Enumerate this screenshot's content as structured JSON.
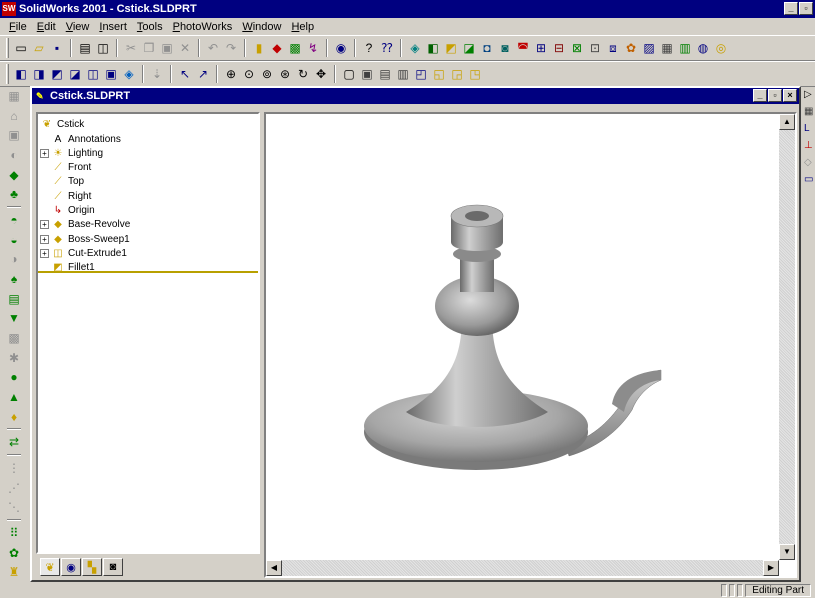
{
  "app": {
    "logo_text": "SW",
    "title": "SolidWorks 2001 - Cstick.SLDPRT",
    "controls": [
      "_",
      "▫",
      "×"
    ]
  },
  "menu": [
    {
      "u": "F",
      "rest": "ile"
    },
    {
      "u": "E",
      "rest": "dit"
    },
    {
      "u": "V",
      "rest": "iew"
    },
    {
      "u": "I",
      "rest": "nsert"
    },
    {
      "u": "T",
      "rest": "ools"
    },
    {
      "u": "P",
      "rest": "hotoWorks"
    },
    {
      "u": "W",
      "rest": "indow"
    },
    {
      "u": "H",
      "rest": "elp"
    }
  ],
  "toolbar_standard": [
    {
      "name": "new-icon",
      "glyph": "▭",
      "color": "#000000"
    },
    {
      "name": "open-icon",
      "glyph": "▱",
      "color": "#c8a000"
    },
    {
      "name": "save-icon",
      "glyph": "▪",
      "color": "#000080"
    },
    {
      "sep": true
    },
    {
      "name": "print-icon",
      "glyph": "▤",
      "color": "#000000"
    },
    {
      "name": "print-preview-icon",
      "glyph": "◫",
      "color": "#000000"
    },
    {
      "sep": true
    },
    {
      "name": "cut-icon",
      "glyph": "✂",
      "color": "#909090"
    },
    {
      "name": "copy-icon",
      "glyph": "❐",
      "color": "#909090"
    },
    {
      "name": "paste-icon",
      "glyph": "▣",
      "color": "#909090"
    },
    {
      "name": "delete-icon",
      "glyph": "✕",
      "color": "#909090"
    },
    {
      "sep": true
    },
    {
      "name": "undo-icon",
      "glyph": "↶",
      "color": "#909090"
    },
    {
      "name": "redo-icon",
      "glyph": "↷",
      "color": "#909090"
    },
    {
      "sep": true
    },
    {
      "name": "rebuild-icon",
      "glyph": "▮",
      "color": "#c8a000"
    },
    {
      "name": "options-icon",
      "glyph": "◆",
      "color": "#c00000"
    },
    {
      "name": "color-icon",
      "glyph": "▩",
      "color": "#008000"
    },
    {
      "name": "edit-sketch-icon",
      "glyph": "↯",
      "color": "#800080"
    },
    {
      "sep": true
    },
    {
      "name": "photoworks-icon",
      "glyph": "◉",
      "color": "#000080"
    },
    {
      "sep": true
    },
    {
      "name": "help-icon",
      "glyph": "?",
      "color": "#000000"
    },
    {
      "name": "whats-this-icon",
      "glyph": "⁇",
      "color": "#000080"
    },
    {
      "sep": true
    },
    {
      "name": "feature-1-icon",
      "glyph": "◈",
      "color": "#008080"
    },
    {
      "name": "feature-2-icon",
      "glyph": "◧",
      "color": "#006000"
    },
    {
      "name": "feature-3-icon",
      "glyph": "◩",
      "color": "#c8a000"
    },
    {
      "name": "feature-4-icon",
      "glyph": "◪",
      "color": "#008000"
    },
    {
      "name": "feature-5-icon",
      "glyph": "◘",
      "color": "#004080"
    },
    {
      "name": "feature-6-icon",
      "glyph": "◙",
      "color": "#006060"
    },
    {
      "name": "feature-7-icon",
      "glyph": "◚",
      "color": "#c00000"
    },
    {
      "name": "feature-8-icon",
      "glyph": "⊞",
      "color": "#000080"
    },
    {
      "name": "feature-9-icon",
      "glyph": "⊟",
      "color": "#800000"
    },
    {
      "name": "feature-10-icon",
      "glyph": "⊠",
      "color": "#008000"
    },
    {
      "name": "feature-11-icon",
      "glyph": "⊡",
      "color": "#404040"
    },
    {
      "name": "feature-12-icon",
      "glyph": "⧈",
      "color": "#000080"
    },
    {
      "name": "feature-13-icon",
      "glyph": "✿",
      "color": "#c06000"
    },
    {
      "name": "feature-14-icon",
      "glyph": "▨",
      "color": "#000080"
    },
    {
      "name": "feature-15-icon",
      "glyph": "▦",
      "color": "#404040"
    },
    {
      "name": "feature-16-icon",
      "glyph": "▥",
      "color": "#008000"
    },
    {
      "name": "feature-17-icon",
      "glyph": "◍",
      "color": "#000080"
    },
    {
      "name": "feature-18-icon",
      "glyph": "◎",
      "color": "#c8a000"
    }
  ],
  "toolbar_view": [
    {
      "name": "view-front-icon",
      "glyph": "◧",
      "color": "#000080"
    },
    {
      "name": "view-back-icon",
      "glyph": "◨",
      "color": "#000080"
    },
    {
      "name": "view-left-icon",
      "glyph": "◩",
      "color": "#000080"
    },
    {
      "name": "view-right-icon",
      "glyph": "◪",
      "color": "#000080"
    },
    {
      "name": "view-top-icon",
      "glyph": "◫",
      "color": "#000080"
    },
    {
      "name": "view-bottom-icon",
      "glyph": "▣",
      "color": "#000080"
    },
    {
      "name": "view-iso-icon",
      "glyph": "◈",
      "color": "#0060c0"
    },
    {
      "sep": true
    },
    {
      "name": "normal-to-icon",
      "glyph": "⇣",
      "color": "#909090"
    },
    {
      "sep": true
    },
    {
      "name": "select-icon",
      "glyph": "↖",
      "color": "#000080"
    },
    {
      "name": "select-other-icon",
      "glyph": "↗",
      "color": "#000080"
    },
    {
      "sep": true
    },
    {
      "name": "zoom-fit-icon",
      "glyph": "⊕",
      "color": "#000000"
    },
    {
      "name": "zoom-area-icon",
      "glyph": "⊙",
      "color": "#000000"
    },
    {
      "name": "zoom-in-out-icon",
      "glyph": "⊚",
      "color": "#000000"
    },
    {
      "name": "zoom-selection-icon",
      "glyph": "⊛",
      "color": "#000000"
    },
    {
      "name": "rotate-icon",
      "glyph": "↻",
      "color": "#000000"
    },
    {
      "name": "pan-icon",
      "glyph": "✥",
      "color": "#000000"
    },
    {
      "sep": true
    },
    {
      "name": "wireframe-icon",
      "glyph": "▢",
      "color": "#000000"
    },
    {
      "name": "hidden-gray-icon",
      "glyph": "▣",
      "color": "#404040"
    },
    {
      "name": "hidden-removed-icon",
      "glyph": "▤",
      "color": "#404040"
    },
    {
      "name": "draft-quality-icon",
      "glyph": "▥",
      "color": "#404040"
    },
    {
      "name": "shaded-edges-icon",
      "glyph": "◰",
      "color": "#000080"
    },
    {
      "name": "shaded-icon",
      "glyph": "◱",
      "color": "#c8a000"
    },
    {
      "name": "shadow-icon",
      "glyph": "◲",
      "color": "#c8a000"
    },
    {
      "name": "perspective-icon",
      "glyph": "◳",
      "color": "#c8a000"
    }
  ],
  "left_toolbar": [
    {
      "name": "sketch-icon",
      "glyph": "▦",
      "color": "#909090"
    },
    {
      "name": "extrude-gray-icon",
      "glyph": "⌂",
      "color": "#909090"
    },
    {
      "name": "revolve-gray-icon",
      "glyph": "▣",
      "color": "#909090"
    },
    {
      "name": "sweep-gray-icon",
      "glyph": "◐",
      "color": "#909090"
    },
    {
      "name": "boss-extrude-icon",
      "glyph": "◆",
      "color": "#008000"
    },
    {
      "name": "boss-revolve-icon",
      "glyph": "♣",
      "color": "#008000"
    },
    {
      "sep": true
    },
    {
      "name": "cut-extrude-icon",
      "glyph": "◓",
      "color": "#008000"
    },
    {
      "name": "cut-revolve-icon",
      "glyph": "◒",
      "color": "#008000"
    },
    {
      "name": "cut-sweep-icon",
      "glyph": "◑",
      "color": "#909090"
    },
    {
      "name": "fillet-icon",
      "glyph": "♠",
      "color": "#008000"
    },
    {
      "name": "chamfer-icon",
      "glyph": "▤",
      "color": "#008000"
    },
    {
      "name": "shell-icon",
      "glyph": "▼",
      "color": "#008000"
    },
    {
      "name": "draft-icon",
      "glyph": "▩",
      "color": "#909090"
    },
    {
      "name": "rib-icon",
      "glyph": "✱",
      "color": "#909090"
    },
    {
      "name": "hole-icon",
      "glyph": "●",
      "color": "#008000"
    },
    {
      "name": "dome-icon",
      "glyph": "▲",
      "color": "#008000"
    },
    {
      "name": "shape-icon",
      "glyph": "♦",
      "color": "#c8a000"
    },
    {
      "sep": true
    },
    {
      "name": "mirror-icon",
      "glyph": "⇄",
      "color": "#008000"
    },
    {
      "sep": true
    },
    {
      "name": "pattern-linear-icon",
      "glyph": "⋮",
      "color": "#909090"
    },
    {
      "name": "pattern-circular-icon",
      "glyph": "⋰",
      "color": "#909090"
    },
    {
      "name": "pattern-table-icon",
      "glyph": "⋱",
      "color": "#909090"
    },
    {
      "sep": true
    },
    {
      "name": "curve-driven-pattern-icon",
      "glyph": "⠿",
      "color": "#008000"
    },
    {
      "name": "sketch-pattern-icon",
      "glyph": "✿",
      "color": "#008000"
    },
    {
      "name": "mirror-all-icon",
      "glyph": "♜",
      "color": "#c8a000"
    }
  ],
  "right_strip": [
    {
      "name": "task-pane-icon",
      "glyph": "▷",
      "color": "#000000"
    },
    {
      "name": "grid-icon",
      "glyph": "▦",
      "color": "#404040"
    },
    {
      "name": "layer-icon",
      "glyph": "L",
      "color": "#000080"
    },
    {
      "name": "axis-icon",
      "glyph": "⊥",
      "color": "#c00000"
    },
    {
      "name": "plane-icon",
      "glyph": "◇",
      "color": "#909090"
    },
    {
      "name": "frame-icon",
      "glyph": "▭",
      "color": "#000080"
    }
  ],
  "document": {
    "title": "Cstick.SLDPRT",
    "controls": [
      "_",
      "▫",
      "×"
    ]
  },
  "tree": {
    "root": "Cstick",
    "items": [
      {
        "label": "Annotations",
        "name": "tree-item-annotations",
        "icon": "annotations-icon",
        "glyph": "A",
        "color": "#000000",
        "expander": false
      },
      {
        "label": "Lighting",
        "name": "tree-item-lighting",
        "icon": "lighting-icon",
        "glyph": "☀",
        "color": "#c8a000",
        "expander": true
      },
      {
        "label": "Front",
        "name": "tree-item-front",
        "icon": "plane-front-icon",
        "glyph": "⟋",
        "color": "#c8a000",
        "expander": false
      },
      {
        "label": "Top",
        "name": "tree-item-top",
        "icon": "plane-top-icon",
        "glyph": "⟋",
        "color": "#c8a000",
        "expander": false
      },
      {
        "label": "Right",
        "name": "tree-item-right",
        "icon": "plane-right-icon",
        "glyph": "⟋",
        "color": "#c8a000",
        "expander": false
      },
      {
        "label": "Origin",
        "name": "tree-item-origin",
        "icon": "origin-icon",
        "glyph": "↳",
        "color": "#c00000",
        "expander": false
      },
      {
        "label": "Base-Revolve",
        "name": "tree-item-base-revolve",
        "icon": "revolve-icon",
        "glyph": "◆",
        "color": "#c8a000",
        "expander": true
      },
      {
        "label": "Boss-Sweep1",
        "name": "tree-item-boss-sweep",
        "icon": "sweep-icon",
        "glyph": "◆",
        "color": "#c8a000",
        "expander": true
      },
      {
        "label": "Cut-Extrude1",
        "name": "tree-item-cut-extrude",
        "icon": "cut-extrude-icon",
        "glyph": "◫",
        "color": "#c8a000",
        "expander": true
      },
      {
        "label": "Fillet1",
        "name": "tree-item-fillet",
        "icon": "fillet-icon",
        "glyph": "◩",
        "color": "#c8a000",
        "expander": false
      }
    ],
    "tabs": [
      {
        "name": "feature-manager-tab",
        "glyph": "❦",
        "color": "#c8a000",
        "active": true
      },
      {
        "name": "property-manager-tab",
        "glyph": "◉",
        "color": "#000080",
        "active": false
      },
      {
        "name": "configuration-manager-tab",
        "glyph": "▚",
        "color": "#c8a000",
        "active": false
      },
      {
        "name": "photoworks-tab",
        "glyph": "◙",
        "color": "#000000",
        "active": false
      }
    ]
  },
  "status": {
    "mode": "Editing Part"
  }
}
